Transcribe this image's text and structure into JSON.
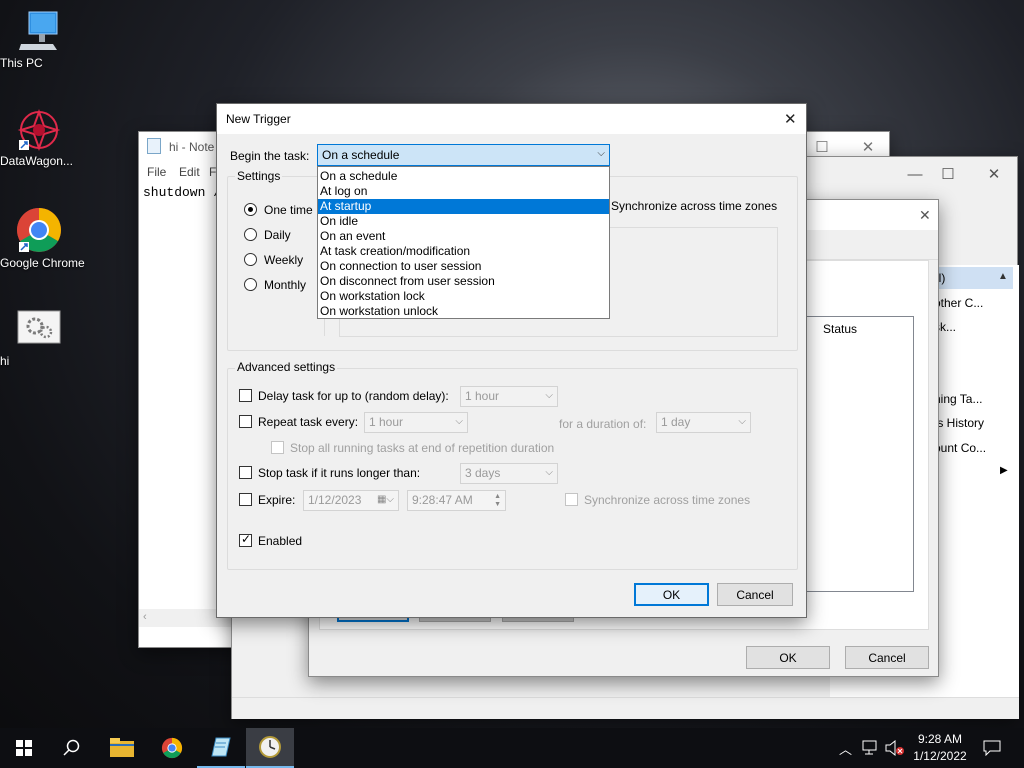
{
  "desktop": {
    "icons": [
      {
        "label": "This PC",
        "icon": "computer-icon"
      },
      {
        "label": "DataWagon...",
        "icon": "datawagon-icon"
      },
      {
        "label": "Google Chrome",
        "icon": "chrome-icon"
      },
      {
        "label": "hi",
        "icon": "settings-file-icon"
      }
    ]
  },
  "notepad": {
    "title": "hi - Note",
    "menu": [
      "File",
      "Edit",
      "F"
    ],
    "content": "shutdown /"
  },
  "task_window": {
    "list_items": [
      "al)",
      "other C...",
      "sk...",
      "ning Ta...",
      "ts History",
      "ount Co..."
    ],
    "status_header": "Status",
    "ok_label": "OK",
    "cancel_label": "Cancel"
  },
  "dialog": {
    "title": "New Trigger",
    "begin_label": "Begin the task:",
    "begin_value": "On a schedule",
    "dropdown_options": [
      "On a schedule",
      "At log on",
      "At startup",
      "On idle",
      "On an event",
      "At task creation/modification",
      "On connection to user session",
      "On disconnect from user session",
      "On workstation lock",
      "On workstation unlock"
    ],
    "dropdown_selected_index": 2,
    "settings_title": "Settings",
    "schedule_options": [
      "One time",
      "Daily",
      "Weekly",
      "Monthly"
    ],
    "sync_zones_label": "Synchronize across time zones",
    "advanced_title": "Advanced settings",
    "delay_label": "Delay task for up to (random delay):",
    "delay_value": "1 hour",
    "repeat_label": "Repeat task every:",
    "repeat_value": "1 hour",
    "duration_label": "for a duration of:",
    "duration_value": "1 day",
    "stop_all_label": "Stop all running tasks at end of repetition duration",
    "stop_longer_label": "Stop task if it runs longer than:",
    "stop_longer_value": "3 days",
    "expire_label": "Expire:",
    "expire_date": "1/12/2023",
    "expire_time": "9:28:47 AM",
    "expire_sync_label": "Synchronize across time zones",
    "enabled_label": "Enabled",
    "enabled_checked": true,
    "ok_label": "OK",
    "cancel_label": "Cancel"
  },
  "taskbar": {
    "time": "9:28 AM",
    "date": "1/12/2022"
  }
}
